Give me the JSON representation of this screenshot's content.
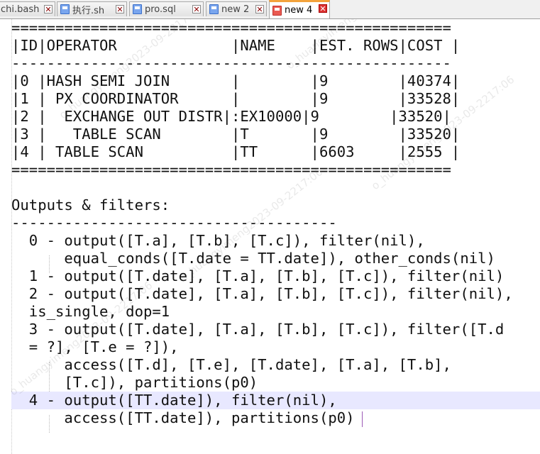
{
  "tabs": [
    {
      "label": "chi.bash",
      "active": false,
      "icon": "save-file-icon"
    },
    {
      "label": "执行.sh",
      "active": false,
      "icon": "save-file-icon"
    },
    {
      "label": "pro.sql",
      "active": false,
      "icon": "save-file-icon"
    },
    {
      "label": "new 2",
      "active": false,
      "icon": "save-file-icon"
    },
    {
      "label": "new 4",
      "active": true,
      "icon": "modified-file-icon"
    }
  ],
  "close_glyph": "✕",
  "editor": {
    "lines": [
      "==================================================",
      "|ID|OPERATOR             |NAME    |EST. ROWS|COST |",
      "--------------------------------------------------",
      "|0 |HASH SEMI JOIN       |        |9        |40374|",
      "|1 | PX COORDINATOR      |        |9        |33528|",
      "|2 |  EXCHANGE OUT DISTR|:EX10000|9        |33520|",
      "|3 |   TABLE SCAN        |T       |9        |33520|",
      "|4 | TABLE SCAN          |TT      |6603     |2555 |",
      "==================================================",
      "",
      "Outputs & filters:",
      "-------------------------------------",
      "  0 - output([T.a], [T.b], [T.c]), filter(nil),",
      "      equal_conds([T.date = TT.date]), other_conds(nil)",
      "  1 - output([T.date], [T.a], [T.b], [T.c]), filter(nil)",
      "  2 - output([T.date], [T.a], [T.b], [T.c]), filter(nil),",
      "  is_single, dop=1",
      "  3 - output([T.date], [T.a], [T.b], [T.c]), filter([T.d",
      "  = ?], [T.e = ?]),",
      "      access([T.d], [T.e], [T.date], [T.a], [T.b],",
      "      [T.c]), partitions(p0)",
      "  4 - output([TT.date]), filter(nil),",
      "      access([TT.date]), partitions(p0)"
    ],
    "current_line_index": 21
  },
  "watermark_text": "o_huangyimeng2023-09-2217:06"
}
